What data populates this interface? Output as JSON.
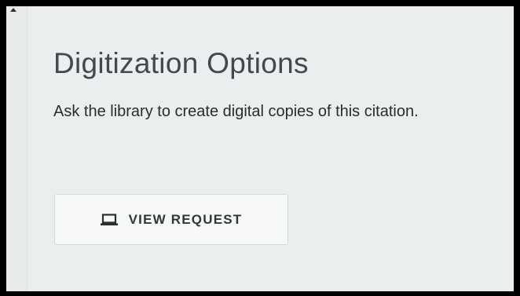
{
  "panel": {
    "title": "Digitization Options",
    "description": "Ask the library to create digital copies of this citation.",
    "button": {
      "label": "VIEW REQUEST",
      "icon": "laptop-icon"
    }
  },
  "colors": {
    "background": "#ebeeee",
    "title_text": "#45474a",
    "body_text": "#2a2c2e",
    "button_bg": "#f6f7f7",
    "button_border": "#d6d9da"
  }
}
